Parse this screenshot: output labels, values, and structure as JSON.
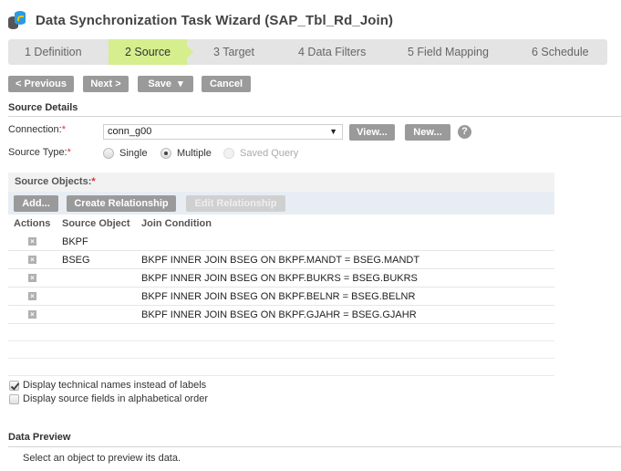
{
  "window": {
    "title": "Data Synchronization Task Wizard (SAP_Tbl_Rd_Join)",
    "icon": "data-sync-task-icon"
  },
  "wizard": {
    "steps": [
      {
        "label": "1  Definition",
        "active": false
      },
      {
        "label": "2  Source",
        "active": true
      },
      {
        "label": "3  Target",
        "active": false
      },
      {
        "label": "4  Data Filters",
        "active": false
      },
      {
        "label": "5  Field Mapping",
        "active": false
      },
      {
        "label": "6  Schedule",
        "active": false
      }
    ]
  },
  "toolbar": {
    "previous_label": "< Previous",
    "next_label": "Next >",
    "save_label": "Save",
    "save_caret": "▾",
    "cancel_label": "Cancel"
  },
  "source_details": {
    "section_title": "Source Details",
    "connection_label": "Connection:",
    "connection_value": "conn_g00",
    "dropdown_arrow": "▼",
    "view_label": "View...",
    "new_label": "New...",
    "help_glyph": "?",
    "required_mark": "*",
    "source_type_label": "Source Type:",
    "source_type_options": [
      {
        "label": "Single",
        "checked": false,
        "disabled": false
      },
      {
        "label": "Multiple",
        "checked": true,
        "disabled": false
      },
      {
        "label": "Saved Query",
        "checked": false,
        "disabled": true
      }
    ]
  },
  "source_objects": {
    "header": "Source Objects:",
    "add_label": "Add...",
    "create_relationship_label": "Create Relationship",
    "edit_relationship_label": "Edit Relationship",
    "columns": [
      "Actions",
      "Source Object",
      "Join Condition"
    ],
    "delete_glyph": "×",
    "rows": [
      {
        "source_object": "BKPF",
        "join_condition": ""
      },
      {
        "source_object": "BSEG",
        "join_condition": "BKPF INNER JOIN BSEG ON BKPF.MANDT = BSEG.MANDT"
      },
      {
        "source_object": "",
        "join_condition": "BKPF INNER JOIN BSEG ON BKPF.BUKRS = BSEG.BUKRS"
      },
      {
        "source_object": "",
        "join_condition": "BKPF INNER JOIN BSEG ON BKPF.BELNR = BSEG.BELNR"
      },
      {
        "source_object": "",
        "join_condition": "BKPF INNER JOIN BSEG ON BKPF.GJAHR = BSEG.GJAHR"
      }
    ]
  },
  "options": {
    "technical_names_label": "Display technical names instead of labels",
    "technical_names_checked": true,
    "alphabetical_label": "Display source fields in alphabetical order",
    "alphabetical_checked": false
  },
  "data_preview": {
    "section_title": "Data Preview",
    "message": "Select an object to preview its data."
  }
}
